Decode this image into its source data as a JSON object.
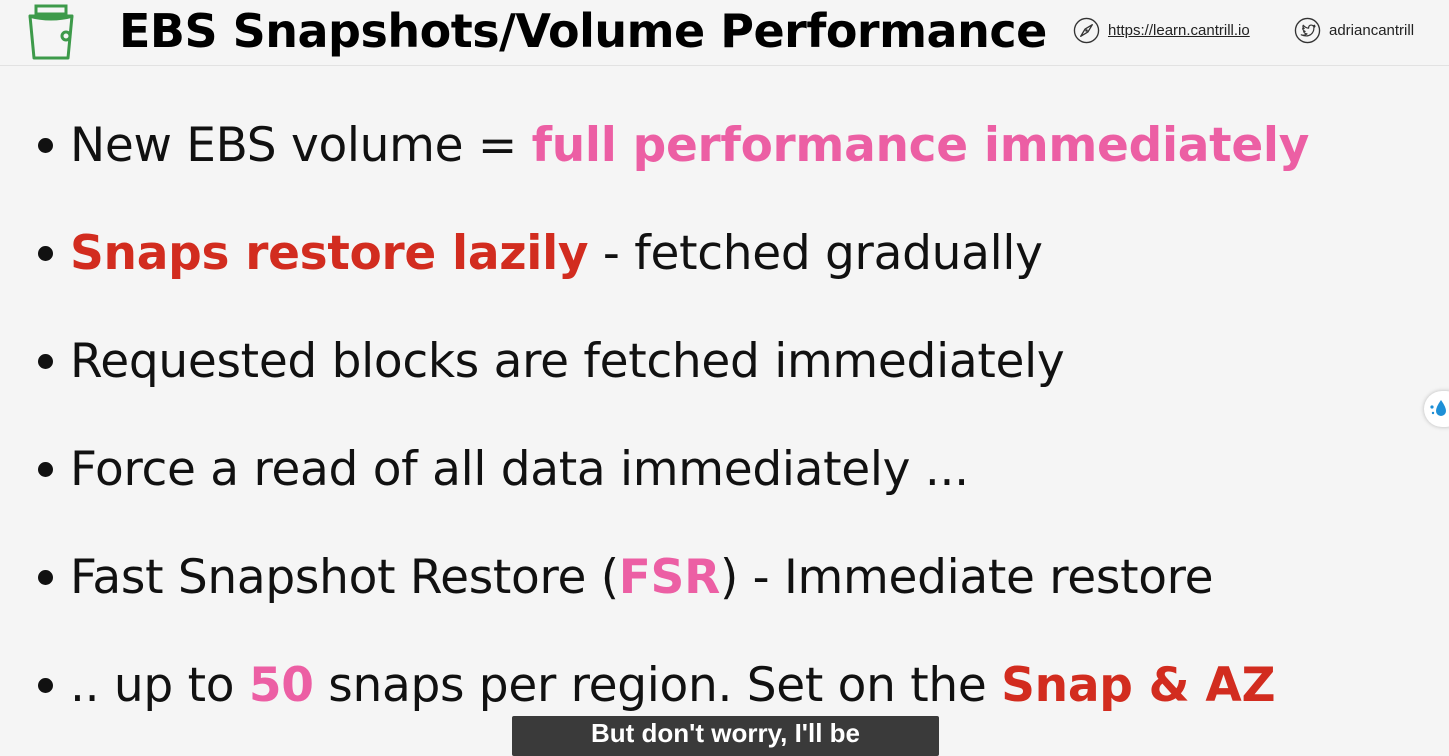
{
  "header": {
    "title": "EBS Snapshots/Volume Performance",
    "site_link": "https://learn.cantrill.io",
    "social_handle": "adriancantrill",
    "icons": {
      "logo": "bucket-icon",
      "site": "compass-icon",
      "social": "twitter-icon"
    }
  },
  "bullets": [
    {
      "parts": [
        {
          "text": "New EBS volume = "
        },
        {
          "text": "full performance immediately",
          "style": "pink"
        }
      ]
    },
    {
      "parts": [
        {
          "text": "Snaps restore lazily",
          "style": "red"
        },
        {
          "text": " - fetched gradually"
        }
      ]
    },
    {
      "parts": [
        {
          "text": "Requested blocks are fetched immediately"
        }
      ]
    },
    {
      "parts": [
        {
          "text": "Force a read of all data immediately ..."
        }
      ]
    },
    {
      "parts": [
        {
          "text": "Fast Snapshot Restore ("
        },
        {
          "text": "FSR",
          "style": "pink"
        },
        {
          "text": ") - Immediate restore"
        }
      ]
    },
    {
      "parts": [
        {
          "text": ".. up to "
        },
        {
          "text": "50",
          "style": "pink"
        },
        {
          "text": " snaps per region. Set on the "
        },
        {
          "text": "Snap & AZ",
          "style": "red"
        }
      ]
    }
  ],
  "caption": "But don't worry, I'll be",
  "side_widget_icon": "droplet-icon",
  "colors": {
    "pink": "#ec5fa4",
    "red": "#d22c1f",
    "bucket_green": "#3d9a4a",
    "background": "#f5f5f5"
  }
}
